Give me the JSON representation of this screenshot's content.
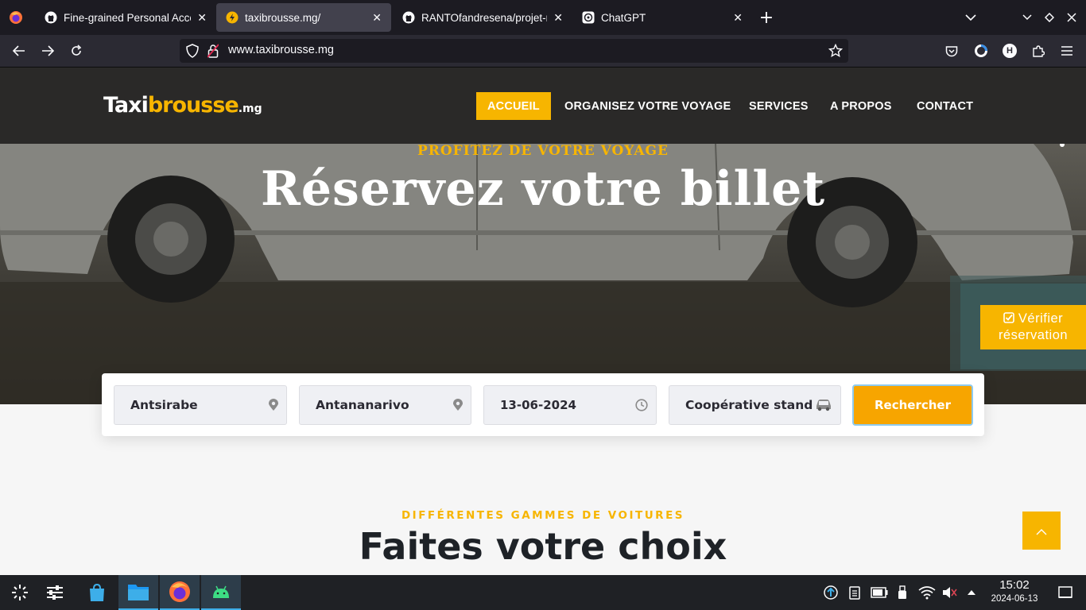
{
  "browser": {
    "tabs": [
      {
        "title": "Fine-grained Personal Access Tokens",
        "icon": "github-icon",
        "active": false
      },
      {
        "title": "taxibrousse.mg/",
        "icon": "taxibrousse-favicon",
        "active": true
      },
      {
        "title": "RANTOfandresena/projet-r",
        "icon": "github-icon",
        "active": false
      },
      {
        "title": "ChatGPT",
        "icon": "chatgpt-icon",
        "active": false
      }
    ],
    "url": "www.taxibrousse.mg",
    "profile_initial": "H"
  },
  "site": {
    "logo": {
      "part1": "Taxi",
      "part2": "brousse",
      "part3": ".mg"
    },
    "menu": [
      "ACCUEIL",
      "ORGANISEZ VOTRE VOYAGE",
      "SERVICES",
      "A PROPOS",
      "CONTACT"
    ],
    "hero_subtitle": "PROFITEZ DE VOTRE VOYAGE",
    "hero_title": "Réservez votre billet",
    "verify_button": "Vérifier réservation",
    "search": {
      "departure": "Antsirabe",
      "arrival": "Antananarivo",
      "date": "13-06-2024",
      "cooperative": "Coopérative stand...",
      "button": "Rechercher"
    },
    "section_subtitle": "DIFFÉRENTES GAMMES DE VOITURES",
    "section_title": "Faites votre choix"
  },
  "taskbar": {
    "time": "15:02",
    "date": "2024-06-13"
  },
  "colors": {
    "accent": "#f7b500",
    "header_bg": "#2a2928",
    "browser_bg": "#1c1b22"
  }
}
